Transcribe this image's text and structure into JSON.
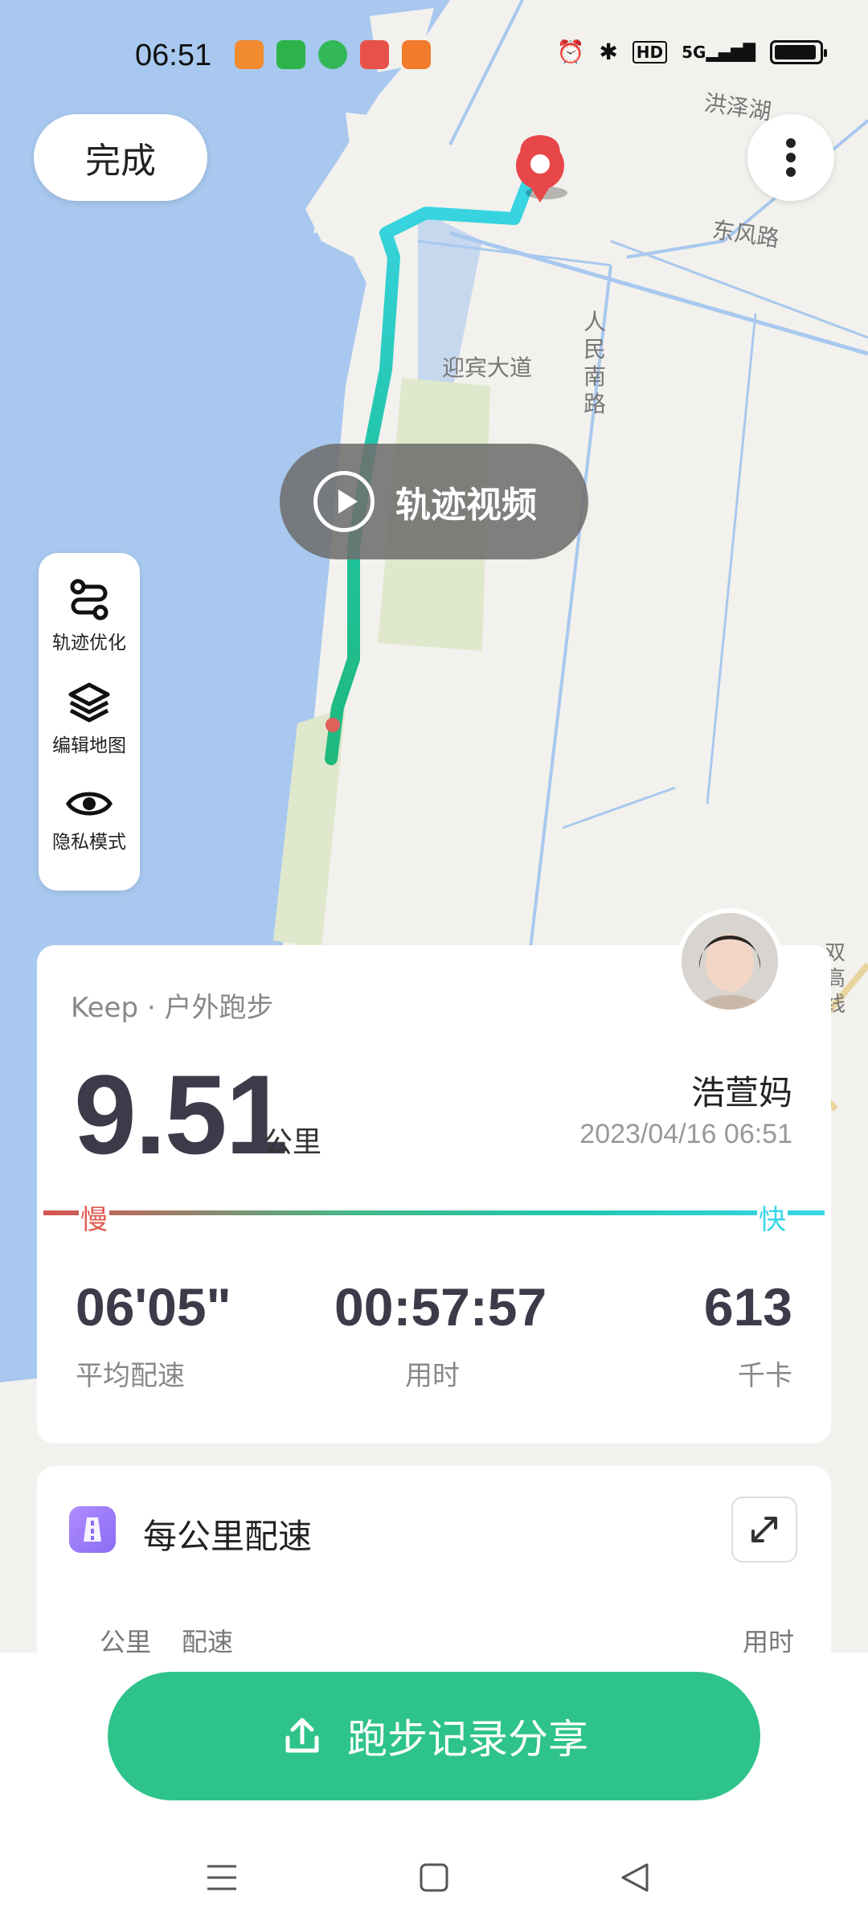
{
  "status_bar": {
    "time": "06:51",
    "network": "5G",
    "hd": "HD",
    "app_icon_colors": [
      "#f28a30",
      "#2db34a",
      "#33b858",
      "#e8514a",
      "#f37b2c"
    ]
  },
  "map": {
    "done_label": "完成",
    "labels": {
      "hongze": "洪泽湖",
      "dongfeng": "东风路",
      "renmin": "人民南路",
      "yingbin": "迎宾大道",
      "shuanggao": "双高线"
    },
    "video_label": "轨迹视频",
    "tools": [
      {
        "label": "轨迹优化",
        "icon": "route-optimize-icon"
      },
      {
        "label": "编辑地图",
        "icon": "layers-icon"
      },
      {
        "label": "隐私模式",
        "icon": "eye-icon"
      }
    ]
  },
  "summary": {
    "source": "Keep · 户外跑步",
    "distance": "9.51",
    "distance_unit": "公里",
    "username": "浩萱妈",
    "date": "2023/04/16 06:51",
    "slow_label": "慢",
    "fast_label": "快",
    "stats": [
      {
        "value": "06'05\"",
        "label": "平均配速"
      },
      {
        "value": "00:57:57",
        "label": "用时"
      },
      {
        "value": "613",
        "label": "千卡"
      }
    ]
  },
  "pace_card": {
    "title": "每公里配速",
    "col_km": "公里",
    "col_pace": "配速",
    "col_time": "用时"
  },
  "share": {
    "label": "跑步记录分享"
  },
  "colors": {
    "accent": "#2ec38a",
    "route_start": "#1fb97d",
    "route_end": "#3ad6e8",
    "water": "#a7c7ee",
    "pin": "#e8474a"
  }
}
